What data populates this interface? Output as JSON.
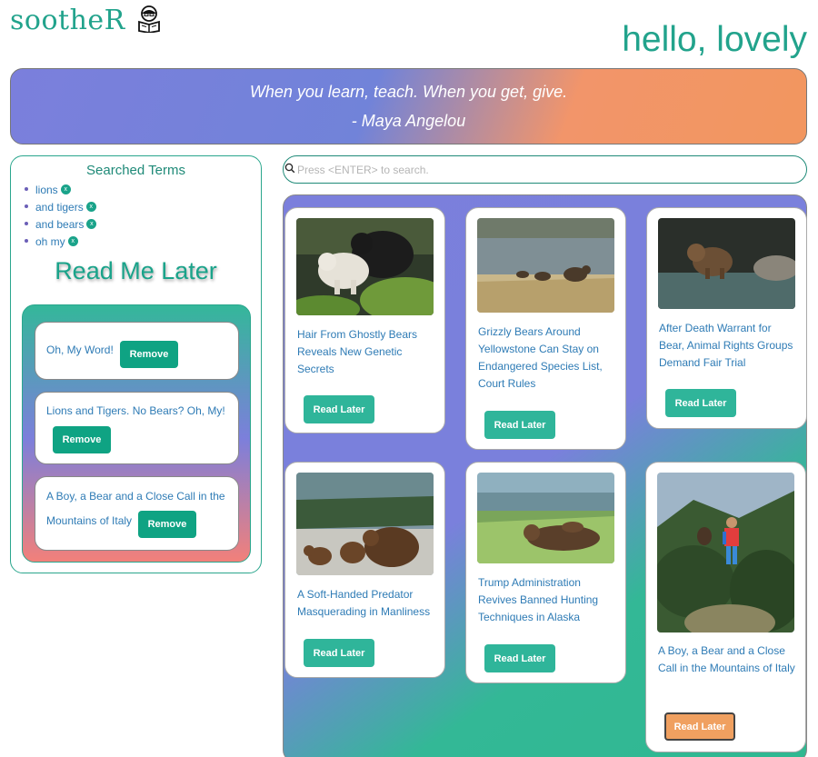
{
  "app": {
    "logo": "sootheR",
    "greeting": "hello, lovely",
    "logo_icon": "reader-icon"
  },
  "quote": {
    "text": "When you learn, teach. When you get, give.",
    "author": "- Maya Angelou"
  },
  "searched": {
    "title": "Searched Terms",
    "terms": [
      {
        "label": "lions",
        "remove": "x"
      },
      {
        "label": "and tigers",
        "remove": "x"
      },
      {
        "label": "and bears",
        "remove": "x"
      },
      {
        "label": "oh my",
        "remove": "x"
      }
    ]
  },
  "read_later": {
    "title": "Read Me Later",
    "items": [
      {
        "title": "Oh, My Word!",
        "remove_label": "Remove"
      },
      {
        "title": "Lions and Tigers. No Bears? Oh, My!",
        "remove_label": "Remove"
      },
      {
        "title_line1": "A Boy, a Bear and a Close Call in the",
        "title_line2": "Mountains of Italy",
        "remove_label": "Remove"
      }
    ]
  },
  "search": {
    "placeholder": "Press <ENTER> to search."
  },
  "articles": [
    {
      "title": "Hair From Ghostly Bears Reveals New Genetic Secrets",
      "button": "Read Later",
      "image": "spirit-bear-photo"
    },
    {
      "title": "Grizzly Bears Around Yellowstone Can Stay on Endangered Species List, Court Rules",
      "button": "Read Later",
      "image": "grizzly-river-photo"
    },
    {
      "title": "After Death Warrant for Bear, Animal Rights Groups Demand Fair Trial",
      "button": "Read Later",
      "image": "bear-in-water-photo"
    },
    {
      "title": "A Soft-Handed Predator Masquerading in Manliness",
      "button": "Read Later",
      "image": "bear-family-photo"
    },
    {
      "title": "Trump Administration Revives Banned Hunting Techniques in Alaska",
      "button": "Read Later",
      "image": "resting-bear-photo"
    },
    {
      "title": "A Boy, a Bear and a Close Call in the Mountains of Italy",
      "button": "Read Later",
      "image": "boy-and-bear-photo"
    }
  ],
  "colors": {
    "brand": "#22a38c",
    "button": "#2fb59a",
    "link": "#2e7bb5",
    "active_button": "#f0a060"
  }
}
